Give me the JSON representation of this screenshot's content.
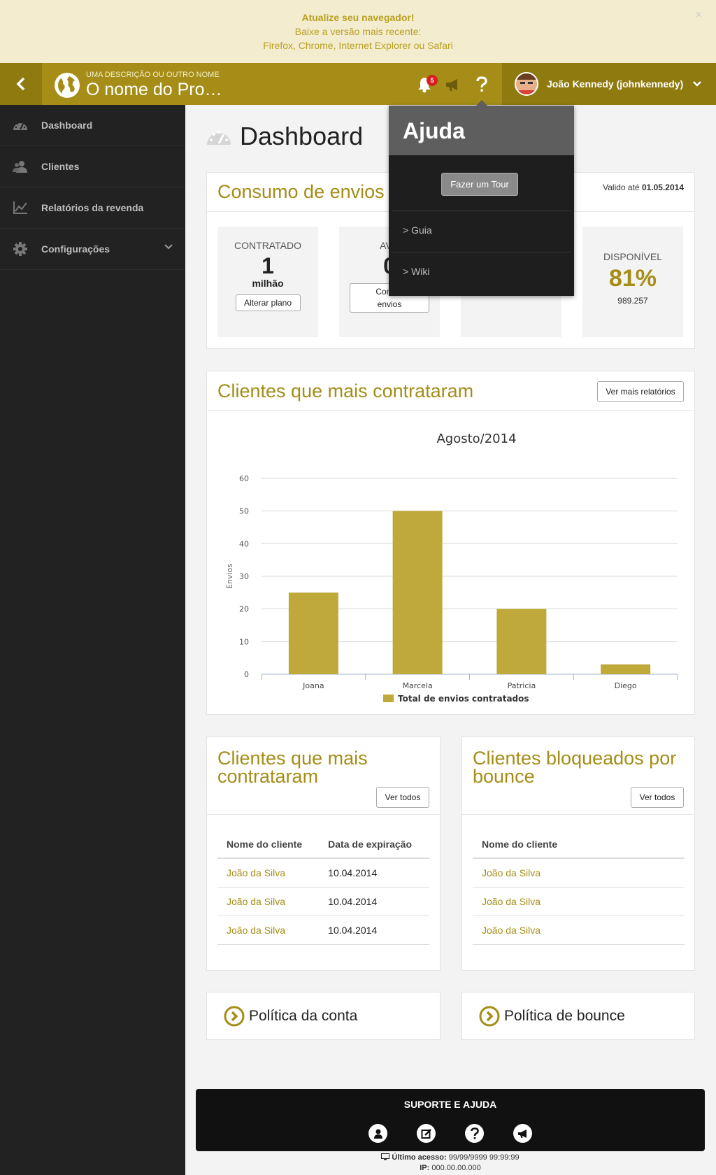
{
  "banner": {
    "title": "Atualize seu navegador!",
    "line2": "Baixe a versão mais recente:",
    "line3": "Firefox, Chrome, Internet Explorer ou Safari",
    "close": "×"
  },
  "header": {
    "subtitle": "UMA DESCRIÇÃO OU OUTRO NOME",
    "title": "O nome do Pro…",
    "notification_count": "5",
    "user_name": "João Kennedy (johnkennedy)"
  },
  "sidebar": {
    "items": [
      {
        "label": "Dashboard",
        "icon": "dashboard-icon"
      },
      {
        "label": "Clientes",
        "icon": "users-icon"
      },
      {
        "label": "Relatórios da revenda",
        "icon": "chart-icon"
      },
      {
        "label": "Configurações",
        "icon": "gear-icon"
      }
    ]
  },
  "page": {
    "title": "Dashboard"
  },
  "consumo": {
    "title": "Consumo de envios",
    "valid_prefix": "Valido até ",
    "valid_date": "01.05.2014",
    "contratado_label": "CONTRATADO",
    "contratado_value": "1",
    "contratado_unit": "milhão",
    "alterar_btn": "Alterar plano",
    "avulso_label": "AVU",
    "avulso_value": "0",
    "contratar_btn_line1": "Contrat",
    "contratar_btn_line2": "envios",
    "disponivel_label": "DISPONÍVEL",
    "disponivel_percent": "81%",
    "disponivel_value": "989.257"
  },
  "top_clients_chart": {
    "panel_title": "Clientes que mais contrataram",
    "more_btn": "Ver mais relatórios"
  },
  "chart_data": {
    "type": "bar",
    "title": "Agosto/2014",
    "ylabel": "Envios",
    "xlabel": "",
    "categories": [
      "Joana",
      "Marcela",
      "Patricia",
      "Diego"
    ],
    "series": [
      {
        "name": "Total de envios contratados",
        "values": [
          25,
          50,
          20,
          3
        ]
      }
    ],
    "ylim": [
      0,
      60
    ],
    "yticks": [
      "0",
      "10",
      "20",
      "30",
      "40",
      "50",
      "60"
    ],
    "grid": true,
    "legend": "bottom",
    "color": "#bfa93a"
  },
  "table_top": {
    "title_line1": "Clientes que mais",
    "title_line2": "contrataram",
    "btn": "Ver todos",
    "headers": [
      "Nome do cliente",
      "Data de expiração"
    ],
    "rows": [
      [
        "João da Silva",
        "10.04.2014"
      ],
      [
        "João da Silva",
        "10.04.2014"
      ],
      [
        "João da Silva",
        "10.04.2014"
      ]
    ]
  },
  "table_bounce": {
    "title_line1": "Clientes bloqueados por",
    "title_line2": "bounce",
    "btn": "Ver todos",
    "headers": [
      "Nome do cliente"
    ],
    "rows": [
      [
        "João da Silva"
      ],
      [
        "João da Silva"
      ],
      [
        "João da Silva"
      ]
    ]
  },
  "policies": {
    "conta": "Política da conta",
    "bounce": "Política de bounce"
  },
  "help": {
    "title": "Ajuda",
    "tour_btn": "Fazer um Tour",
    "guia": "> Guia",
    "wiki": "> Wiki"
  },
  "footer": {
    "title": "SUPORTE E AJUDA",
    "last_access_label": "Último acesso:",
    "last_access_value": "99/99/9999 99:99:99",
    "ip_label": "IP:",
    "ip_value": "000.00.00.000"
  },
  "colors": {
    "brand": "#a58d17",
    "brand_dark": "#8f7a10",
    "bar": "#bfa93a",
    "sidebar": "#222222"
  }
}
